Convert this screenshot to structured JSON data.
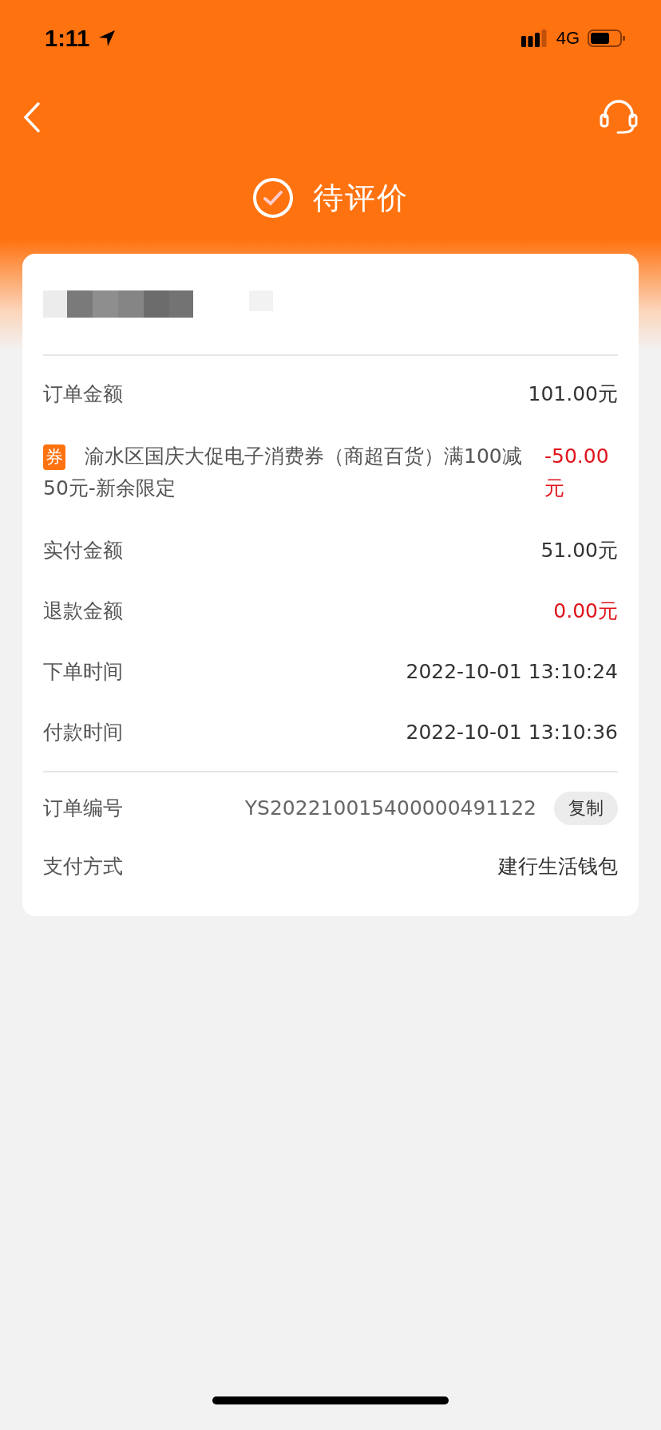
{
  "status_bar": {
    "time": "1:11",
    "network": "4G"
  },
  "status": {
    "title": "待评价"
  },
  "sections": [
    [
      {
        "kind": "amount",
        "label": "订单金额",
        "value": "101.00元",
        "alert": false
      },
      {
        "kind": "coupon",
        "badge": "券",
        "label": "渝水区国庆大促电子消费券（商超百货）满100减50元-新余限定",
        "value": "-50.00元",
        "alert": true
      },
      {
        "kind": "amount",
        "label": "实付金额",
        "value": "51.00元",
        "alert": false
      },
      {
        "kind": "amount",
        "label": "退款金额",
        "value": "0.00元",
        "alert": true
      },
      {
        "kind": "amount",
        "label": "下单时间",
        "value": "2022-10-01 13:10:24",
        "alert": false
      },
      {
        "kind": "amount",
        "label": "付款时间",
        "value": "2022-10-01 13:10:36",
        "alert": false
      }
    ],
    [
      {
        "kind": "order-id",
        "label": "订单编号",
        "value": "YS202210015400000491122",
        "action": "复制"
      },
      {
        "kind": "amount",
        "label": "支付方式",
        "value": "建行生活钱包",
        "alert": false
      }
    ]
  ]
}
